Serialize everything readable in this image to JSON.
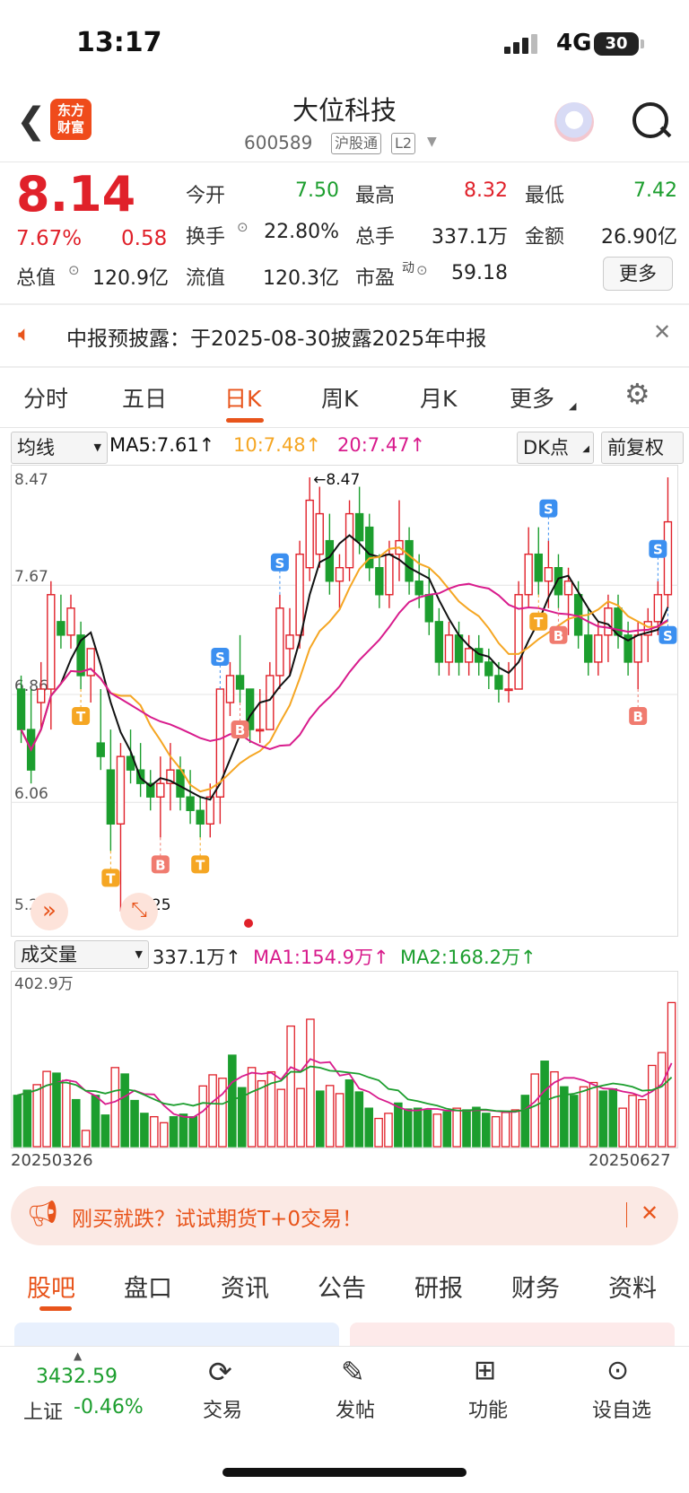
{
  "status_bar": {
    "time": "13:17",
    "network": "4G",
    "battery": "30"
  },
  "header": {
    "stock_name": "大位科技",
    "stock_code": "600589",
    "tag_hgt": "沪股通",
    "tag_l2": "L2",
    "logo_line1": "东方",
    "logo_line2": "财富"
  },
  "quote": {
    "price": "8.14",
    "change_pct": "7.67%",
    "change": "0.58",
    "open_label": "今开",
    "open": "7.50",
    "high_label": "最高",
    "high": "8.32",
    "low_label": "最低",
    "low": "7.42",
    "turnover_label": "换手",
    "turnover": "22.80%",
    "volume_label": "总手",
    "volume": "337.1万",
    "amount_label": "金额",
    "amount": "26.90亿",
    "mktcap_label": "总值",
    "mktcap": "120.9亿",
    "float_label": "流值",
    "float_cap": "120.3亿",
    "pe_label": "市盈",
    "pe_sup": "动",
    "pe": "59.18",
    "more_label": "更多"
  },
  "notice": {
    "text": "中报预披露：于2025-08-30披露2025年中报"
  },
  "period_tabs": [
    "分时",
    "五日",
    "日K",
    "周K",
    "月K",
    "更多"
  ],
  "chart_toolbar": {
    "indicator": "均线",
    "ma5": "MA5:7.61↑",
    "ma10": "10:7.48↑",
    "ma20": "20:7.47↑",
    "dk": "DK点",
    "adjust": "前复权"
  },
  "volume_toolbar": {
    "indicator": "成交量",
    "vol": "337.1万↑",
    "ma1": "MA1:154.9万↑",
    "ma2": "MA2:168.2万↑"
  },
  "colors": {
    "up": "#e0212a",
    "down": "#1c9e2e",
    "accent": "#e8541b",
    "ma5": "#111111",
    "ma10": "#f5a623",
    "ma20": "#d81b8c"
  },
  "chart_data": [
    {
      "type": "candlestick",
      "title": "",
      "y_tick_labels": [
        "8.47",
        "7.67",
        "6.86",
        "6.06",
        "5.25"
      ],
      "ylim": [
        5.25,
        8.47
      ],
      "x_start": "20250326",
      "x_end": "20250627",
      "annotations": {
        "max_label": "8.47",
        "min_label": "5.25"
      },
      "signals": [
        "T",
        "S",
        "B"
      ],
      "candles": [
        [
          6.9,
          7.0,
          6.5,
          6.6
        ],
        [
          6.6,
          6.9,
          6.2,
          6.3
        ],
        [
          6.8,
          7.1,
          6.6,
          6.9
        ],
        [
          6.9,
          7.7,
          6.6,
          7.6
        ],
        [
          7.4,
          7.6,
          7.2,
          7.3
        ],
        [
          7.3,
          7.6,
          7.2,
          7.5
        ],
        [
          7.3,
          7.4,
          6.9,
          7.0
        ],
        [
          7.0,
          7.2,
          6.8,
          7.2
        ],
        [
          6.5,
          6.9,
          6.3,
          6.4
        ],
        [
          6.3,
          6.6,
          5.7,
          5.9
        ],
        [
          5.9,
          6.5,
          5.25,
          6.4
        ],
        [
          6.4,
          6.6,
          6.2,
          6.3
        ],
        [
          6.3,
          6.5,
          6.1,
          6.2
        ],
        [
          6.2,
          6.3,
          6.0,
          6.1
        ],
        [
          6.1,
          6.4,
          5.8,
          6.2
        ],
        [
          6.2,
          6.5,
          6.0,
          6.3
        ],
        [
          6.3,
          6.4,
          6.0,
          6.1
        ],
        [
          6.1,
          6.3,
          5.9,
          6.0
        ],
        [
          6.0,
          6.1,
          5.8,
          5.9
        ],
        [
          5.9,
          6.2,
          5.8,
          6.1
        ],
        [
          6.1,
          6.9,
          5.9,
          6.9
        ],
        [
          6.8,
          7.1,
          6.7,
          7.0
        ],
        [
          7.0,
          7.3,
          6.8,
          6.9
        ],
        [
          6.9,
          6.9,
          6.5,
          6.6
        ],
        [
          6.6,
          6.9,
          6.5,
          6.6
        ],
        [
          6.6,
          7.1,
          6.6,
          7.0
        ],
        [
          7.0,
          7.6,
          6.9,
          7.5
        ],
        [
          7.2,
          7.5,
          7.0,
          7.3
        ],
        [
          7.3,
          8.0,
          7.2,
          7.9
        ],
        [
          7.8,
          8.47,
          7.7,
          8.3
        ],
        [
          7.9,
          8.4,
          7.8,
          8.2
        ],
        [
          8.0,
          8.2,
          7.6,
          7.7
        ],
        [
          7.7,
          7.9,
          7.5,
          7.8
        ],
        [
          7.8,
          8.3,
          7.7,
          8.2
        ],
        [
          8.2,
          8.4,
          7.9,
          8.0
        ],
        [
          8.1,
          8.2,
          7.7,
          7.8
        ],
        [
          7.8,
          7.9,
          7.5,
          7.6
        ],
        [
          7.6,
          8.0,
          7.5,
          7.9
        ],
        [
          7.9,
          8.3,
          7.7,
          8.0
        ],
        [
          8.0,
          8.1,
          7.6,
          7.7
        ],
        [
          7.7,
          7.9,
          7.5,
          7.6
        ],
        [
          7.6,
          7.8,
          7.3,
          7.4
        ],
        [
          7.4,
          7.5,
          7.0,
          7.1
        ],
        [
          7.1,
          7.4,
          7.0,
          7.3
        ],
        [
          7.3,
          7.4,
          7.0,
          7.1
        ],
        [
          7.1,
          7.3,
          7.0,
          7.2
        ],
        [
          7.2,
          7.3,
          7.0,
          7.1
        ],
        [
          7.1,
          7.2,
          6.9,
          7.0
        ],
        [
          7.0,
          7.1,
          6.8,
          6.9
        ],
        [
          6.9,
          7.1,
          6.8,
          6.9
        ],
        [
          6.9,
          7.7,
          6.9,
          7.6
        ],
        [
          7.6,
          8.1,
          7.5,
          7.9
        ],
        [
          7.9,
          8.1,
          7.6,
          7.7
        ],
        [
          7.7,
          8.0,
          7.5,
          7.8
        ],
        [
          7.8,
          7.9,
          7.5,
          7.6
        ],
        [
          7.6,
          7.8,
          7.3,
          7.7
        ],
        [
          7.6,
          7.7,
          7.2,
          7.3
        ],
        [
          7.3,
          7.5,
          7.0,
          7.1
        ],
        [
          7.1,
          7.4,
          7.0,
          7.3
        ],
        [
          7.3,
          7.6,
          7.1,
          7.5
        ],
        [
          7.5,
          7.6,
          7.2,
          7.3
        ],
        [
          7.3,
          7.4,
          7.0,
          7.1
        ],
        [
          7.1,
          7.4,
          6.9,
          7.3
        ],
        [
          7.3,
          7.5,
          7.1,
          7.4
        ],
        [
          7.4,
          7.7,
          7.3,
          7.6
        ],
        [
          7.6,
          8.47,
          7.5,
          8.14
        ]
      ]
    },
    {
      "type": "bar",
      "title": "",
      "y_tick_labels": [
        "402.9万"
      ],
      "ylim": [
        0,
        402.9
      ],
      "values": [
        120,
        132,
        145,
        176,
        172,
        155,
        110,
        38,
        120,
        74,
        185,
        170,
        108,
        78,
        70,
        56,
        70,
        76,
        70,
        142,
        168,
        160,
        214,
        138,
        185,
        154,
        175,
        134,
        282,
        136,
        298,
        130,
        143,
        124,
        156,
        128,
        90,
        66,
        78,
        102,
        88,
        90,
        85,
        76,
        82,
        90,
        86,
        92,
        78,
        70,
        80,
        86,
        120,
        170,
        200,
        175,
        140,
        120,
        140,
        150,
        130,
        135,
        90,
        120,
        110,
        190,
        220,
        337
      ]
    }
  ],
  "ad_banner": {
    "text": "刚买就跌？试试期货T+0交易！"
  },
  "section_tabs": [
    "股吧",
    "盘口",
    "资讯",
    "公告",
    "研报",
    "财务",
    "资料"
  ],
  "bottom_nav": {
    "index_value": "3432.59",
    "index_name": "上证",
    "index_change": "-0.46%",
    "trade": "交易",
    "post": "发帖",
    "func": "功能",
    "watch": "设自选"
  }
}
